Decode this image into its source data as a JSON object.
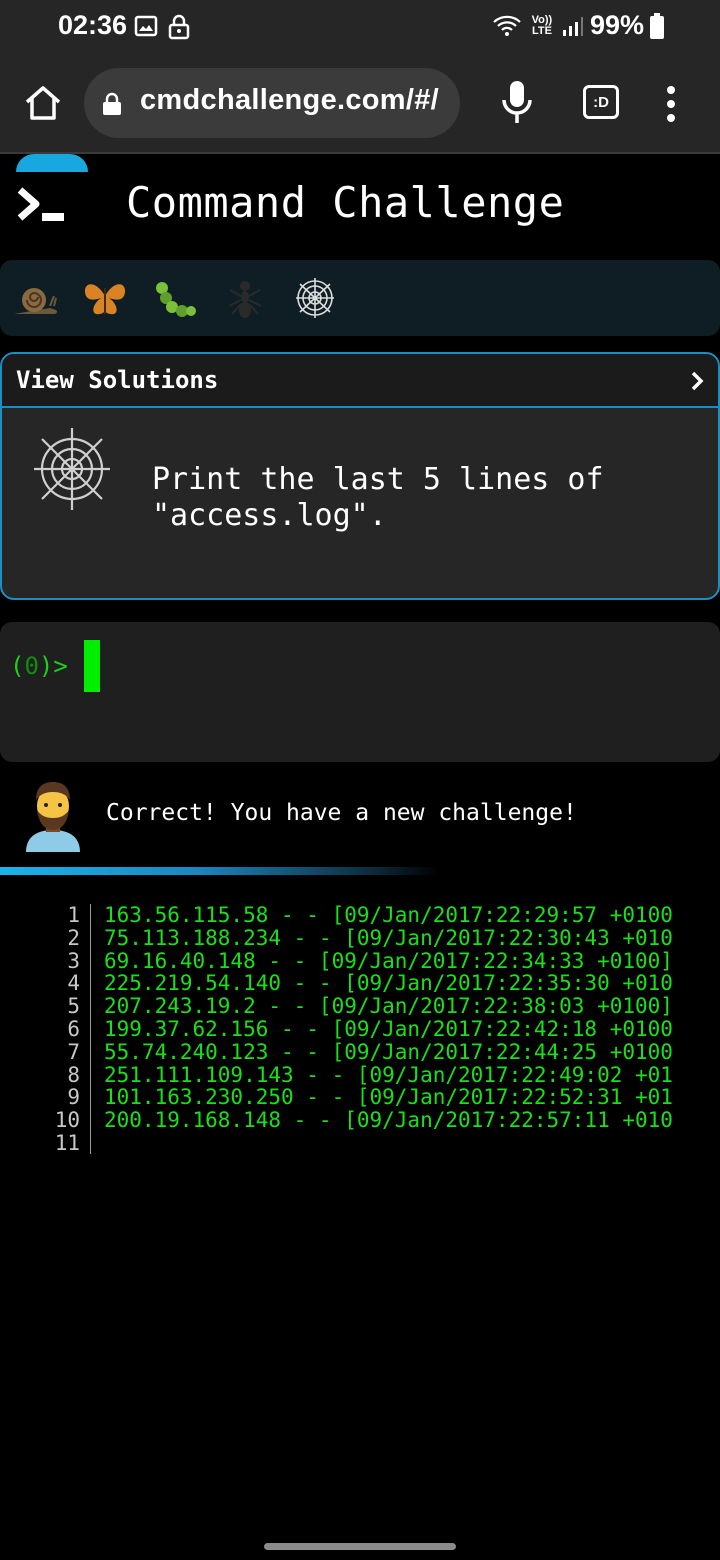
{
  "status_bar": {
    "time": "02:36",
    "battery": "99%",
    "network": "Vo)) LTE"
  },
  "browser": {
    "url": "cmdchallenge.com/#/",
    "icons": [
      "home-icon",
      "lock-icon",
      "microphone-icon",
      "tab-switcher-icon",
      "more-vert-icon"
    ],
    "tab_label": ":D"
  },
  "app": {
    "title": "Command Challenge",
    "badges": [
      "snail-icon",
      "butterfly-icon",
      "caterpillar-icon",
      "ant-icon",
      "spider-web-icon"
    ]
  },
  "challenge": {
    "view_solutions_label": "View Solutions",
    "text": "Print the last 5 lines of\n\"access.log\"."
  },
  "terminal": {
    "prompt_open": "(",
    "prompt_count": "0",
    "prompt_close": ")>"
  },
  "feedback": {
    "message": "Correct! You have a new challenge!"
  },
  "output": {
    "line_numbers": [
      "1",
      "2",
      "3",
      "4",
      "5",
      "6",
      "7",
      "8",
      "9",
      "10",
      "11"
    ],
    "lines": [
      "163.56.115.58 - - [09/Jan/2017:22:29:57 +0100",
      "75.113.188.234 - - [09/Jan/2017:22:30:43 +010",
      "69.16.40.148 - - [09/Jan/2017:22:34:33 +0100]",
      "225.219.54.140 - - [09/Jan/2017:22:35:30 +010",
      "207.243.19.2 - - [09/Jan/2017:22:38:03 +0100]",
      "199.37.62.156 - - [09/Jan/2017:22:42:18 +0100",
      "55.74.240.123 - - [09/Jan/2017:22:44:25 +0100",
      "251.111.109.143 - - [09/Jan/2017:22:49:02 +01",
      "101.163.230.250 - - [09/Jan/2017:22:52:31 +01",
      "200.19.168.148 - - [09/Jan/2017:22:57:11 +010",
      ""
    ]
  },
  "colors": {
    "accent": "#1c8fc2",
    "terminal_green": "#19e019",
    "background": "#000000"
  }
}
